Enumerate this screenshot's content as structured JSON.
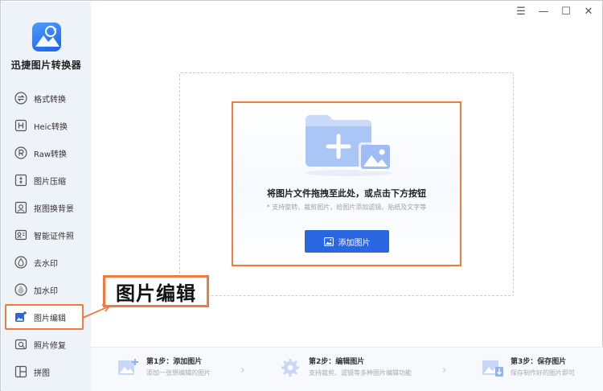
{
  "app": {
    "name": "迅捷图片转换器"
  },
  "window_controls": [
    "☰",
    "—",
    "☐",
    "✕"
  ],
  "sidebar": {
    "items": [
      {
        "label": "格式转换",
        "icon": "swap-icon"
      },
      {
        "label": "Heic转换",
        "icon": "heic-icon"
      },
      {
        "label": "Raw转换",
        "icon": "raw-icon"
      },
      {
        "label": "图片压缩",
        "icon": "compress-icon"
      },
      {
        "label": "抠图换背景",
        "icon": "cutout-icon"
      },
      {
        "label": "智能证件照",
        "icon": "id-photo-icon"
      },
      {
        "label": "去水印",
        "icon": "remove-watermark-icon"
      },
      {
        "label": "加水印",
        "icon": "add-watermark-icon"
      },
      {
        "label": "图片编辑",
        "icon": "image-edit-icon",
        "active": true
      },
      {
        "label": "照片修复",
        "icon": "photo-repair-icon"
      },
      {
        "label": "拼图",
        "icon": "collage-icon"
      }
    ]
  },
  "dropzone": {
    "title": "将图片文件拖拽至此处，或点击下方按钮",
    "subtitle": "* 支持旋转、裁剪图片，给图片添加滤镜、贴纸及文字等",
    "button_label": "添加图片"
  },
  "annotation": {
    "label": "图片编辑"
  },
  "steps": [
    {
      "title": "第1步：添加图片",
      "desc": "添加一张想编辑的图片"
    },
    {
      "title": "第2步：编辑图片",
      "desc": "支持裁剪、滤镜等多种图片编辑功能"
    },
    {
      "title": "第3步：保存图片",
      "desc": "保存制作好的图片即可"
    }
  ],
  "colors": {
    "accent": "#2a66e0",
    "highlight": "#f07a3f",
    "sidebar_bg": "#eef2f9"
  }
}
